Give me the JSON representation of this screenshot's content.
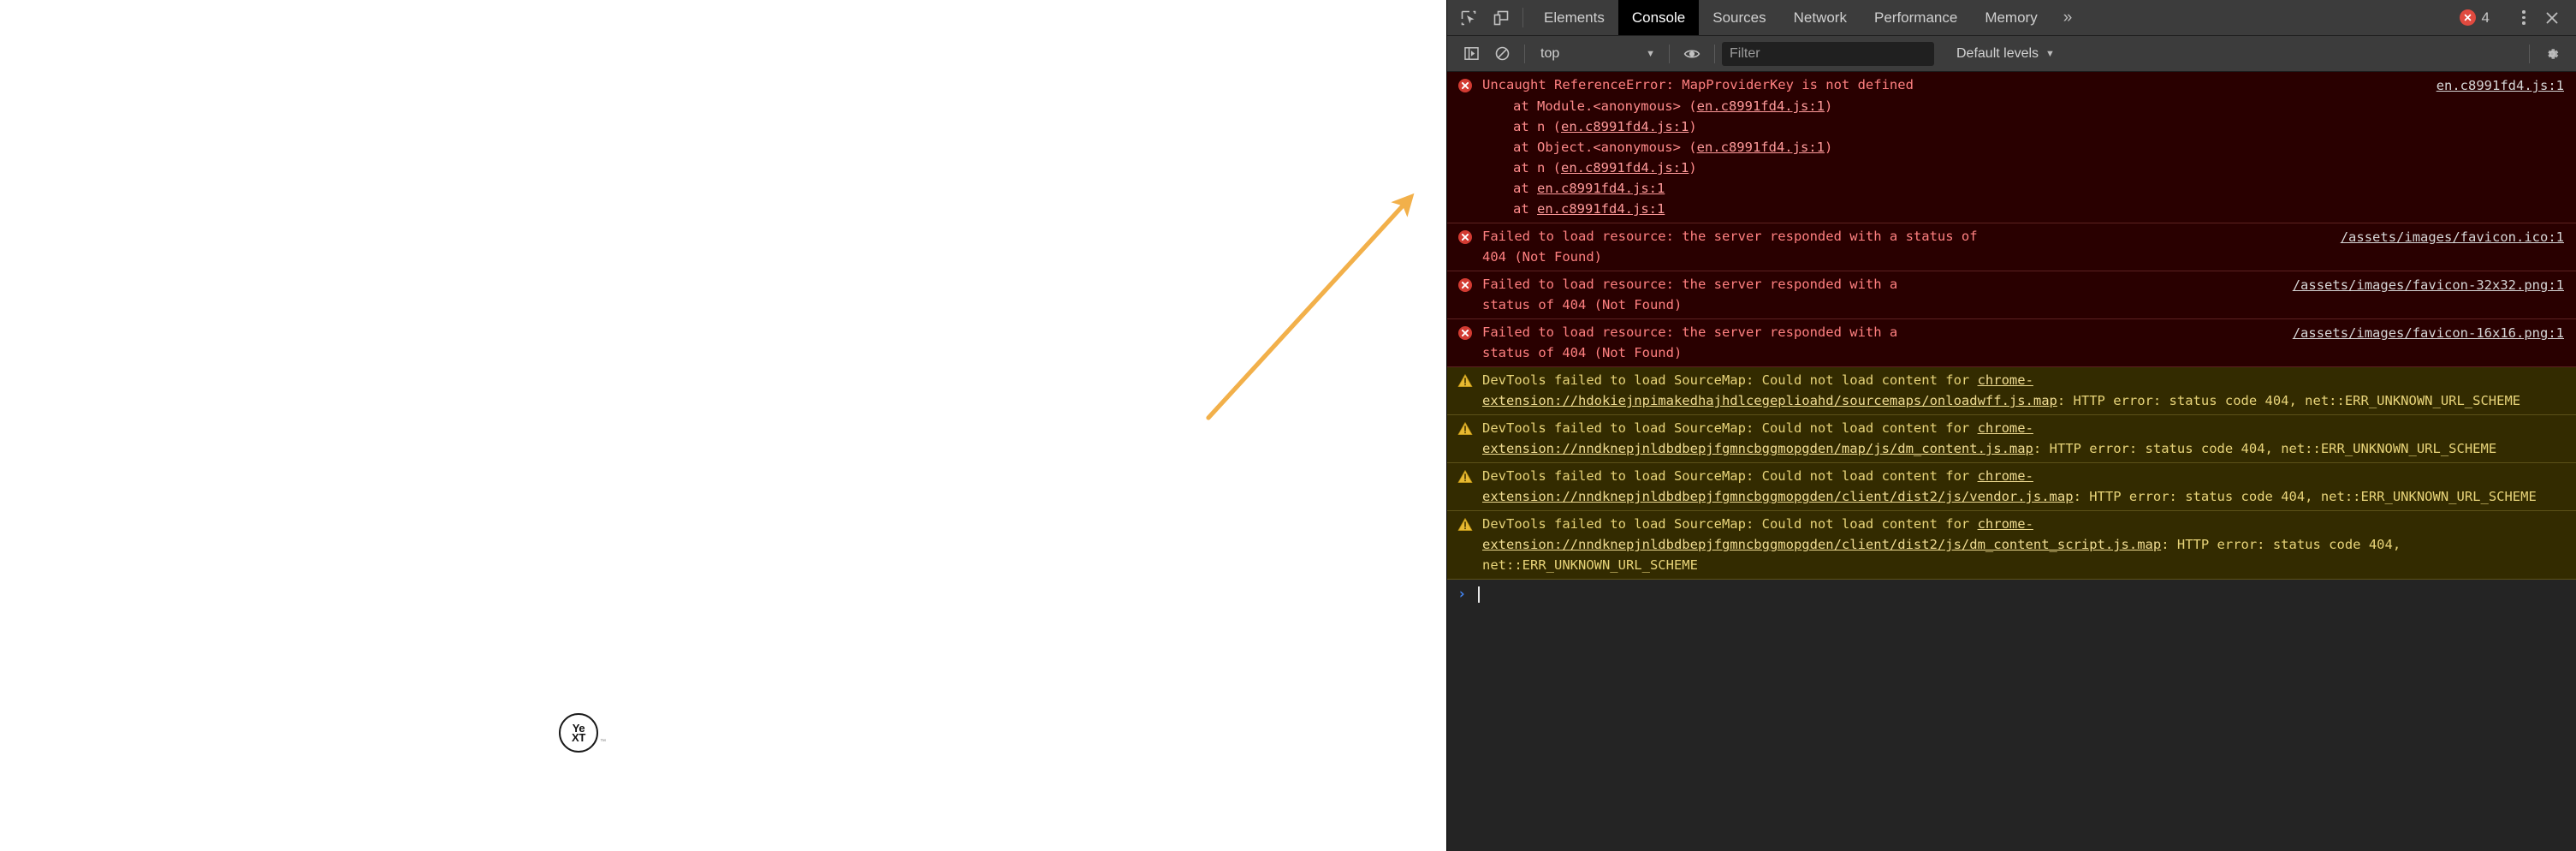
{
  "page": {
    "logo_text_line1": "Ye",
    "logo_text_line2": "XT",
    "logo_tm": "™"
  },
  "annotation": {
    "type": "arrow",
    "color": "#f5b council",
    "arrow_color": "#f2b04a",
    "points_to": "console-error-block"
  },
  "devtools": {
    "tabbar": {
      "inspect_icon": "inspect-element-icon",
      "device_icon": "device-toolbar-icon",
      "tabs": [
        {
          "label": "Elements",
          "active": false
        },
        {
          "label": "Console",
          "active": true
        },
        {
          "label": "Sources",
          "active": false
        },
        {
          "label": "Network",
          "active": false
        },
        {
          "label": "Performance",
          "active": false
        },
        {
          "label": "Memory",
          "active": false
        }
      ],
      "more_tabs_label": "»",
      "error_count": "4",
      "error_badge_icon": "circle-x-icon",
      "kebab_icon": "more-options-icon",
      "close_icon": "close-icon"
    },
    "toolbar": {
      "sidebar_toggle_icon": "show-console-sidebar-icon",
      "clear_icon": "clear-console-icon",
      "context_value": "top",
      "context_caret": "▼",
      "eye_icon": "live-expression-eye-icon",
      "filter_placeholder": "Filter",
      "filter_value": "",
      "levels_label": "Default levels",
      "levels_caret": "▼",
      "settings_icon": "settings-gear-icon"
    },
    "messages": [
      {
        "level": "error",
        "icon": "error-icon",
        "text": "Uncaught ReferenceError: MapProviderKey is not defined",
        "source_link": "en.c8991fd4.js:1",
        "stack": [
          {
            "prefix": "at Module.<anonymous> (",
            "link": "en.c8991fd4.js:1",
            "suffix": ")"
          },
          {
            "prefix": "at n (",
            "link": "en.c8991fd4.js:1",
            "suffix": ")"
          },
          {
            "prefix": "at Object.<anonymous> (",
            "link": "en.c8991fd4.js:1",
            "suffix": ")"
          },
          {
            "prefix": "at n (",
            "link": "en.c8991fd4.js:1",
            "suffix": ")"
          },
          {
            "prefix": "at ",
            "link": "en.c8991fd4.js:1",
            "suffix": ""
          },
          {
            "prefix": "at ",
            "link": "en.c8991fd4.js:1",
            "suffix": ""
          }
        ]
      },
      {
        "level": "error",
        "icon": "error-icon",
        "line1": "Failed to load resource: the server responded with a status of",
        "line2": "404 (Not Found)",
        "source_link": "/assets/images/favicon.ico:1"
      },
      {
        "level": "error",
        "icon": "error-icon",
        "line1": "Failed to load resource: the server responded with a",
        "line2": "status of 404 (Not Found)",
        "source_link": "/assets/images/favicon-32x32.png:1"
      },
      {
        "level": "error",
        "icon": "error-icon",
        "line1": "Failed to load resource: the server responded with a",
        "line2": "status of 404 (Not Found)",
        "source_link": "/assets/images/favicon-16x16.png:1"
      },
      {
        "level": "warning",
        "icon": "warning-icon",
        "prefix": "DevTools failed to load SourceMap: Could not load content for ",
        "link": "chrome-extension://hdokiejnpimakedhajhdlcegeplioahd/sourcemaps/onloadwff.js.map",
        "suffix": ": HTTP error: status code 404, net::ERR_UNKNOWN_URL_SCHEME"
      },
      {
        "level": "warning",
        "icon": "warning-icon",
        "prefix": "DevTools failed to load SourceMap: Could not load content for ",
        "link": "chrome-extension://nndknepjnldbdbepjfgmncbggmopgden/map/js/dm_content.js.map",
        "suffix": ": HTTP error: status code 404, net::ERR_UNKNOWN_URL_SCHEME"
      },
      {
        "level": "warning",
        "icon": "warning-icon",
        "prefix": "DevTools failed to load SourceMap: Could not load content for ",
        "link": "chrome-extension://nndknepjnldbdbepjfgmncbggmopgden/client/dist2/js/vendor.js.map",
        "suffix": ": HTTP error: status code 404, net::ERR_UNKNOWN_URL_SCHEME"
      },
      {
        "level": "warning",
        "icon": "warning-icon",
        "prefix": "DevTools failed to load SourceMap: Could not load content for ",
        "link": "chrome-extension://nndknepjnldbdbepjfgmncbggmopgden/client/dist2/js/dm_content_script.js.map",
        "suffix": ": HTTP error: status code 404, net::ERR_UNKNOWN_URL_SCHEME"
      }
    ],
    "prompt": {
      "caret": "›",
      "value": ""
    },
    "colors": {
      "error_bg": "#290000",
      "error_text": "#ff8080",
      "warning_bg": "#332b00",
      "warning_text": "#e8d479",
      "toolbar_bg": "#3c3c3c",
      "panel_bg": "#242424",
      "accent_blue": "#4285f4",
      "error_badge": "#e04a3f",
      "warning_icon": "#e8b931",
      "annotation_orange": "#f2b04a"
    }
  }
}
